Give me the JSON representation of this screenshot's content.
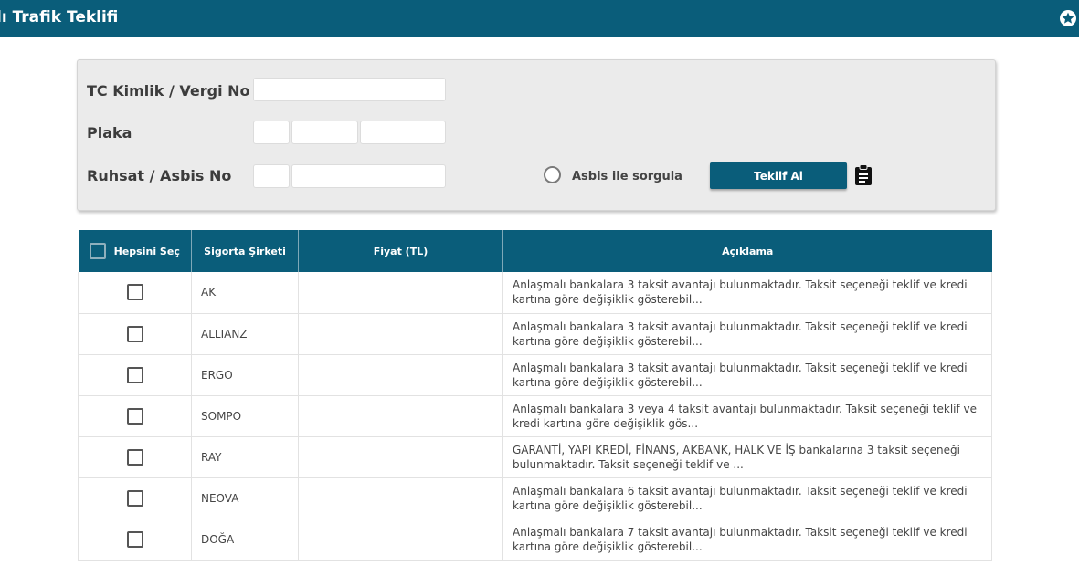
{
  "header": {
    "title": "lı Trafik Teklifi"
  },
  "form": {
    "tc_label": "TC Kimlik / Vergi No",
    "plaka_label": "Plaka",
    "ruhsat_label": "Ruhsat / Asbis No",
    "tc_value": "",
    "plaka_1": "",
    "plaka_2": "",
    "plaka_3": "",
    "ruhsat_1": "",
    "ruhsat_2": "",
    "asbis_label": "Asbis ile sorgula",
    "submit_label": "Teklif Al"
  },
  "table": {
    "headers": [
      "Hepsini Seç",
      "Sigorta Şirketi",
      "Fiyat (TL)",
      "Açıklama"
    ],
    "rows": [
      {
        "company": "AK",
        "price": "",
        "desc": "Anlaşmalı bankalara 3 taksit avantajı bulunmaktadır. Taksit seçeneği teklif ve kredi kartına göre değişiklik gösterebil..."
      },
      {
        "company": "ALLIANZ",
        "price": "",
        "desc": "Anlaşmalı bankalara 3 taksit avantajı bulunmaktadır. Taksit seçeneği teklif ve kredi kartına göre değişiklik gösterebil..."
      },
      {
        "company": "ERGO",
        "price": "",
        "desc": "Anlaşmalı bankalara 3 taksit avantajı bulunmaktadır. Taksit seçeneği teklif ve kredi kartına göre değişiklik gösterebil..."
      },
      {
        "company": "SOMPO",
        "price": "",
        "desc": "Anlaşmalı bankalara 3 veya 4 taksit avantajı bulunmaktadır. Taksit seçeneği teklif ve kredi kartına göre değişiklik gös..."
      },
      {
        "company": "RAY",
        "price": "",
        "desc": "GARANTİ, YAPI KREDİ, FİNANS, AKBANK, HALK VE İŞ bankalarına 3 taksit seçeneği bulunmaktadır. Taksit seçeneği teklif ve ..."
      },
      {
        "company": "NEOVA",
        "price": "",
        "desc": "Anlaşmalı bankalara 6 taksit avantajı bulunmaktadır. Taksit seçeneği teklif ve kredi kartına göre değişiklik gösterebil..."
      },
      {
        "company": "DOĞA",
        "price": "",
        "desc": "Anlaşmalı bankalara 7 taksit avantajı bulunmaktadır. Taksit seçeneği teklif ve kredi kartına göre değişiklik gösterebil..."
      }
    ]
  },
  "icons": {
    "favorite": "star-circle-icon",
    "clipboard": "clipboard-icon"
  },
  "colors": {
    "primary": "#0a5d7a",
    "panel": "#ebebeb"
  }
}
